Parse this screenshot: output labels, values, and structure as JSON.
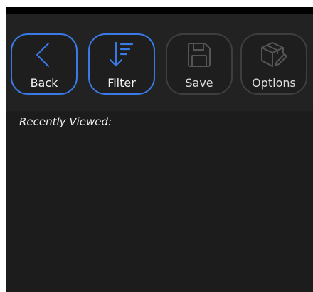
{
  "toolbar": {
    "buttons": [
      {
        "label": "Back",
        "icon": "chevron-left-icon",
        "state": "active"
      },
      {
        "label": "Filter",
        "icon": "sort-down-icon",
        "state": "active"
      },
      {
        "label": "Save",
        "icon": "floppy-disk-icon",
        "state": "disabled"
      },
      {
        "label": "Options",
        "icon": "box-pencil-icon",
        "state": "disabled"
      }
    ]
  },
  "main": {
    "section_title": "Recently Viewed:",
    "items": []
  },
  "colors": {
    "accent": "#3a7ae6",
    "toolbar_bg": "#222222",
    "content_bg": "#1c1c1c",
    "disabled_icon": "#555555"
  }
}
